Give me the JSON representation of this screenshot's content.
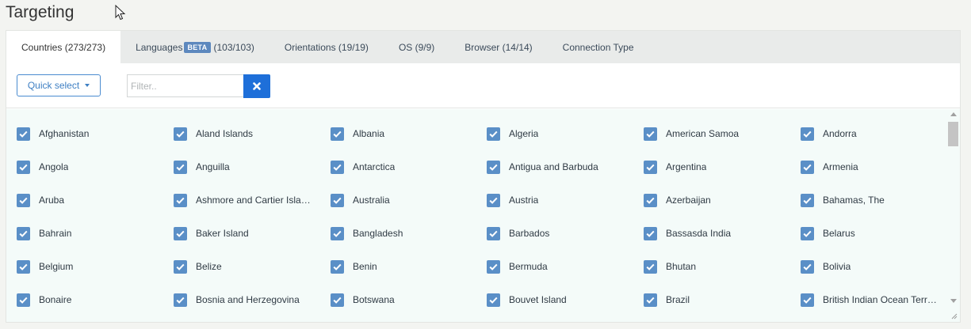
{
  "page": {
    "title": "Targeting"
  },
  "tabs": [
    {
      "label": "Countries (273/273)",
      "active": true
    },
    {
      "label": "Languages",
      "badge": "BETA",
      "count": "(103/103)",
      "active": false
    },
    {
      "label": "Orientations (19/19)",
      "active": false
    },
    {
      "label": "OS (9/9)",
      "active": false
    },
    {
      "label": "Browser (14/14)",
      "active": false
    },
    {
      "label": "Connection Type",
      "active": false
    }
  ],
  "toolbar": {
    "quick_select_label": "Quick select",
    "filter_placeholder": "Filter..",
    "filter_value": ""
  },
  "countries": [
    "Afghanistan",
    "Aland Islands",
    "Albania",
    "Algeria",
    "American Samoa",
    "Andorra",
    "Angola",
    "Anguilla",
    "Antarctica",
    "Antigua and Barbuda",
    "Argentina",
    "Armenia",
    "Aruba",
    "Ashmore and Cartier Islands",
    "Australia",
    "Austria",
    "Azerbaijan",
    "Bahamas, The",
    "Bahrain",
    "Baker Island",
    "Bangladesh",
    "Barbados",
    "Bassasda India",
    "Belarus",
    "Belgium",
    "Belize",
    "Benin",
    "Bermuda",
    "Bhutan",
    "Bolivia",
    "Bonaire",
    "Bosnia and Herzegovina",
    "Botswana",
    "Bouvet Island",
    "Brazil",
    "British Indian Ocean Territory"
  ],
  "colors": {
    "accent": "#1e6fd9",
    "checkbox": "#5a8fc7",
    "badge": "#5d88be",
    "list_background": "#f4fbf9"
  },
  "icons": {
    "clear": "close-icon",
    "checkbox": "checkmark-icon",
    "dropdown": "caret-down-icon"
  }
}
